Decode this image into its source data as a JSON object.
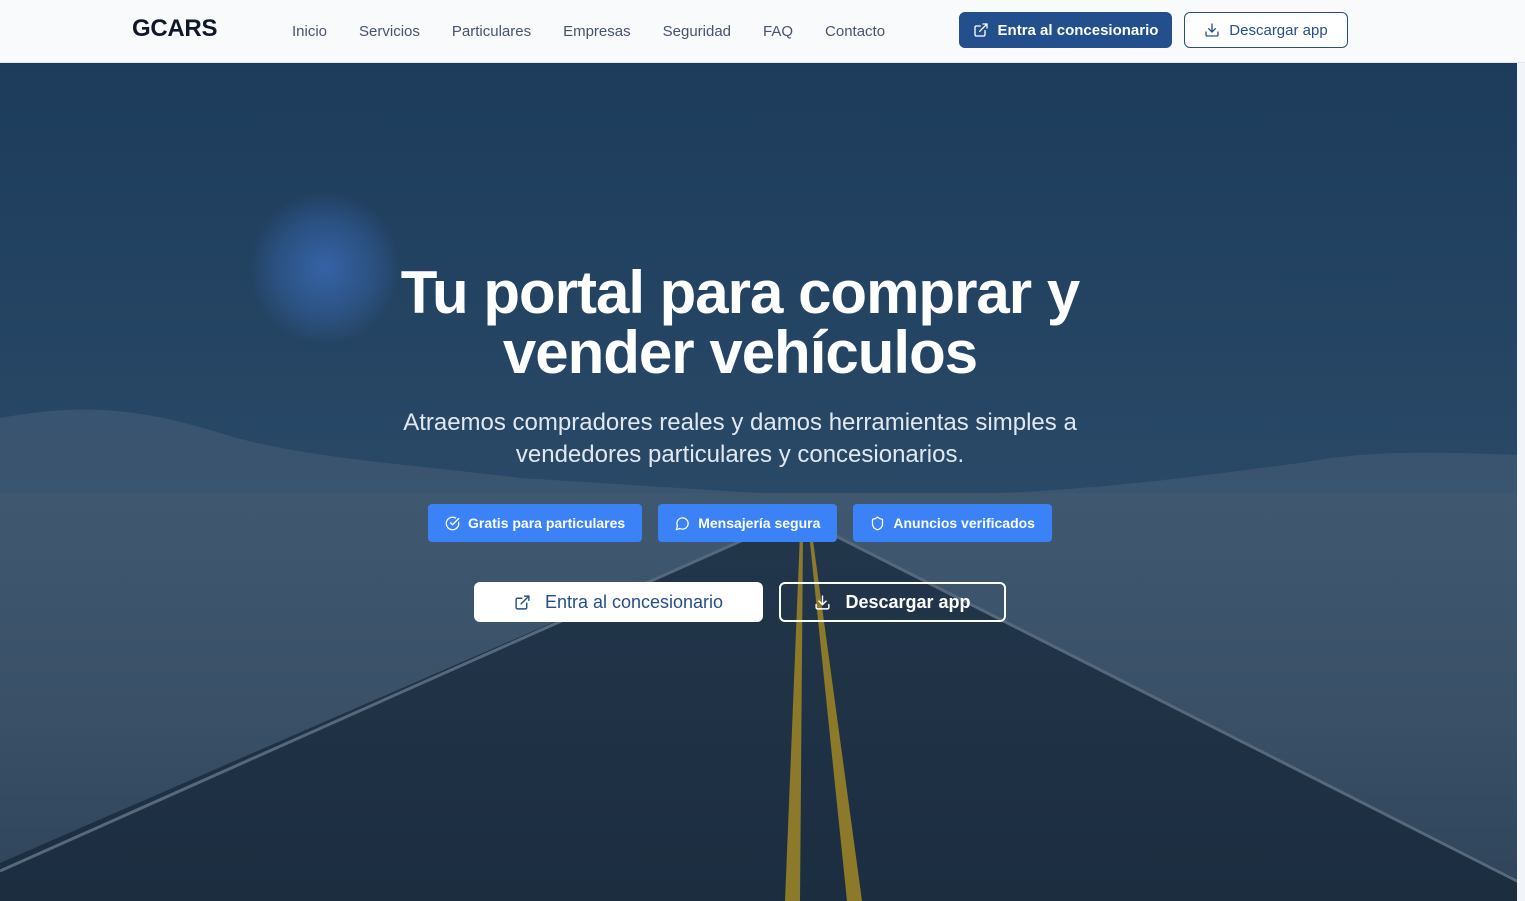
{
  "header": {
    "logo": "GCARS",
    "nav": [
      "Inicio",
      "Servicios",
      "Particulares",
      "Empresas",
      "Seguridad",
      "FAQ",
      "Contacto"
    ],
    "primary_button": {
      "label": "Entra al concesionario",
      "icon": "external-link-icon"
    },
    "secondary_button": {
      "label": "Descargar app",
      "icon": "download-icon"
    }
  },
  "hero": {
    "title_line1": "Tu portal para comprar y",
    "title_line2": "vender vehículos",
    "subtitle_line1": "Atraemos compradores reales y damos herramientas simples a",
    "subtitle_line2": "vendedores particulares y concesionarios.",
    "badges": [
      {
        "label": "Gratis para particulares",
        "icon": "check-circle-icon"
      },
      {
        "label": "Mensajería segura",
        "icon": "message-circle-icon"
      },
      {
        "label": "Anuncios verificados",
        "icon": "shield-icon"
      }
    ],
    "cta_primary": {
      "label": "Entra al concesionario",
      "icon": "external-link-icon"
    },
    "cta_secondary": {
      "label": "Descargar app",
      "icon": "download-icon"
    }
  },
  "colors": {
    "brand": "#234f8c",
    "badge": "#3b82f6",
    "header_bg": "#f8fafc",
    "hero_overlay": "#1f3a55"
  }
}
